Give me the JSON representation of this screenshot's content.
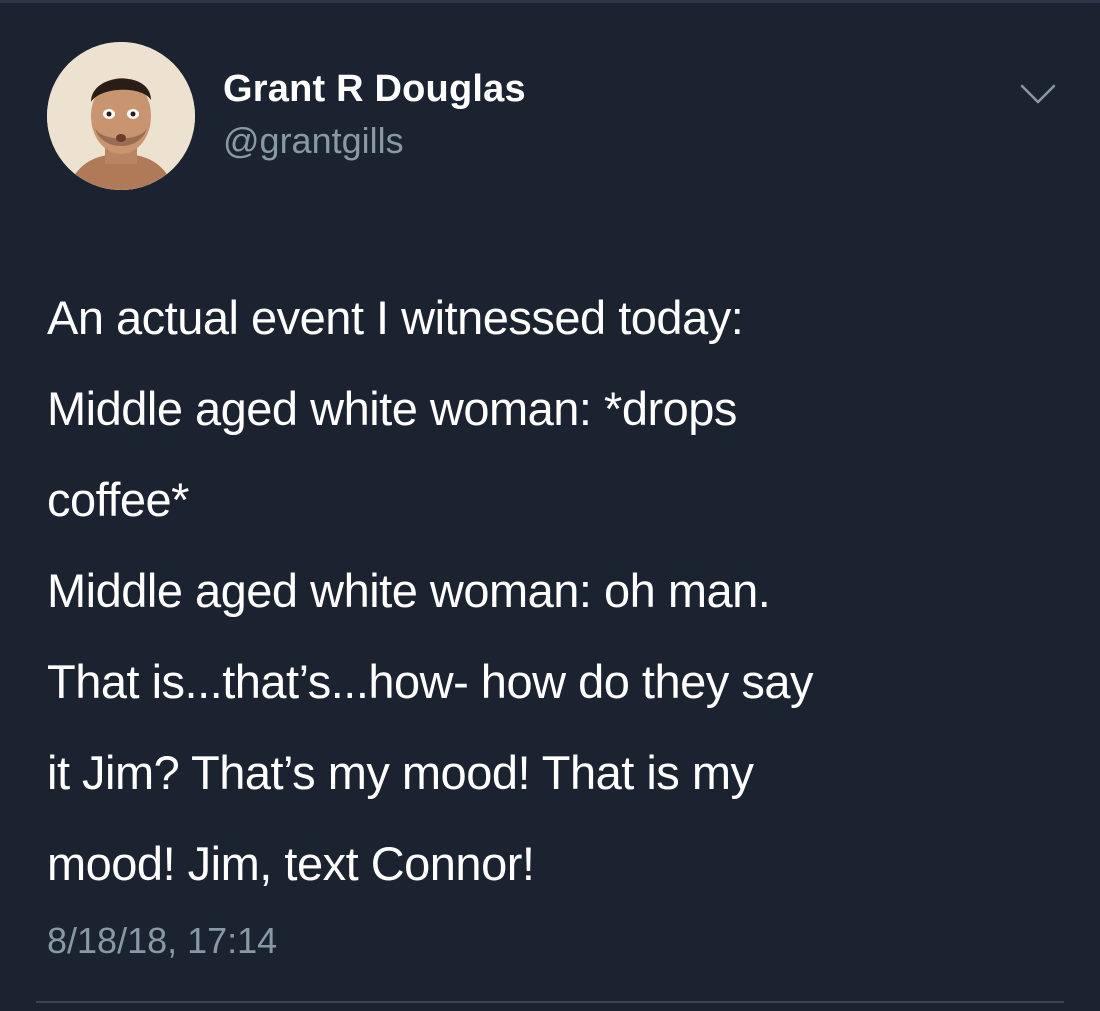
{
  "tweet": {
    "author": {
      "display_name": "Grant R Douglas",
      "handle": "@grantgills",
      "avatar_icon": "profile-photo"
    },
    "menu_icon": "chevron-down-icon",
    "text_lines": [
      "An actual event I witnessed today:",
      "Middle aged white woman: *drops",
      "coffee*",
      "Middle aged white woman: oh man.",
      "That is...that’s...how- how do they say",
      "it Jim? That’s my mood! That is my",
      "mood! Jim, text Connor!"
    ],
    "timestamp": "8/18/18, 17:14"
  },
  "colors": {
    "background": "#1b2330",
    "primary_text": "#ffffff",
    "secondary_text": "#8899a6",
    "divider": "#3a4554"
  }
}
